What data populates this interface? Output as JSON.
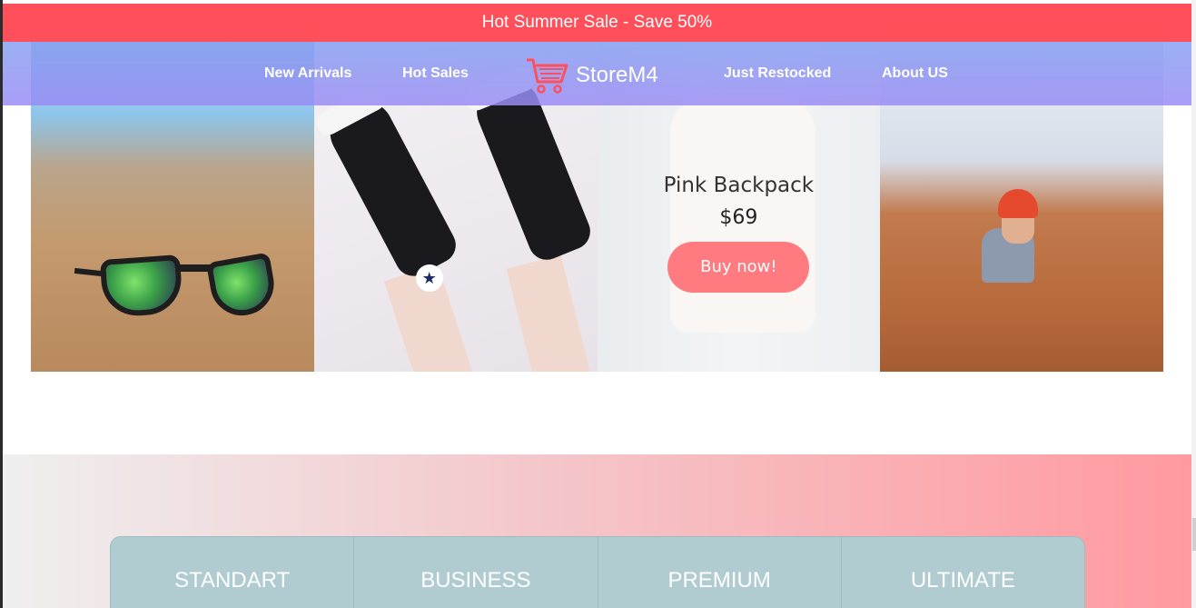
{
  "announcement": {
    "text": "Hot Summer Sale - Save 50%"
  },
  "nav": {
    "links_left": [
      "New Arrivals",
      "Hot Sales"
    ],
    "logo_text": "StoreM4",
    "links_right": [
      "Just Restocked",
      "About US"
    ],
    "logo_icon": "shopping-cart-icon"
  },
  "gallery": {
    "featured": {
      "name": "Pink Backpack",
      "price": "$69",
      "button_label": "Buy now!"
    }
  },
  "pricing": {
    "plans": [
      "STANDART",
      "BUSINESS",
      "PREMIUM",
      "ULTIMATE"
    ]
  },
  "colors": {
    "announcement_bg": "#ff4f5a",
    "buy_button": "#ff7b80",
    "plans_bg": "#b0ccd0"
  }
}
